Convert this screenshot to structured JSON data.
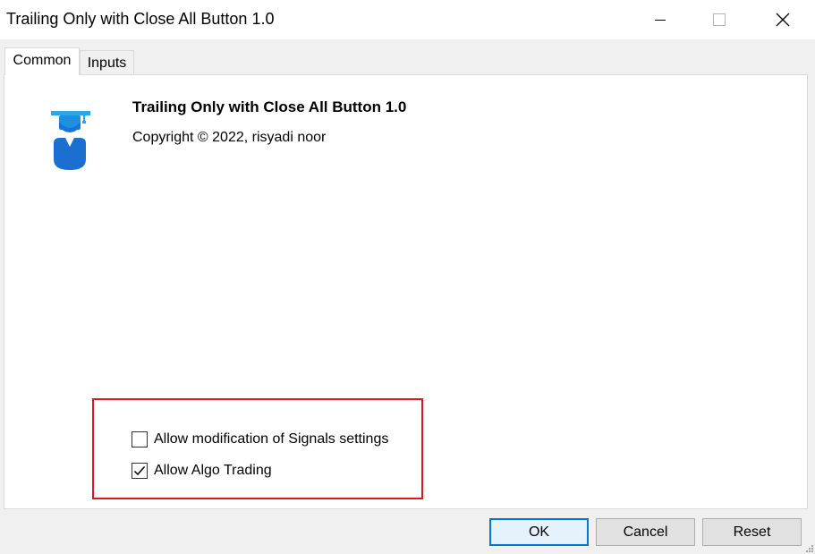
{
  "window": {
    "title": "Trailing Only with Close All Button 1.0",
    "controls": [
      "minimize-icon",
      "maximize-icon",
      "close-icon"
    ]
  },
  "tabs": [
    {
      "label": "Common",
      "active": true
    },
    {
      "label": "Inputs",
      "active": false
    }
  ],
  "info": {
    "name": "Trailing Only with Close All Button 1.0",
    "copyright": "Copyright © 2022, risyadi noor"
  },
  "options": [
    {
      "label": "Allow modification of Signals settings",
      "checked": false
    },
    {
      "label": "Allow Algo Trading",
      "checked": true
    }
  ],
  "buttons": {
    "ok": "OK",
    "cancel": "Cancel",
    "reset": "Reset"
  },
  "colors": {
    "highlight": "#e0161d",
    "default_button_border": "#0078d7",
    "logo_blue": "#1a73d9",
    "logo_cyan": "#29a8e8"
  }
}
